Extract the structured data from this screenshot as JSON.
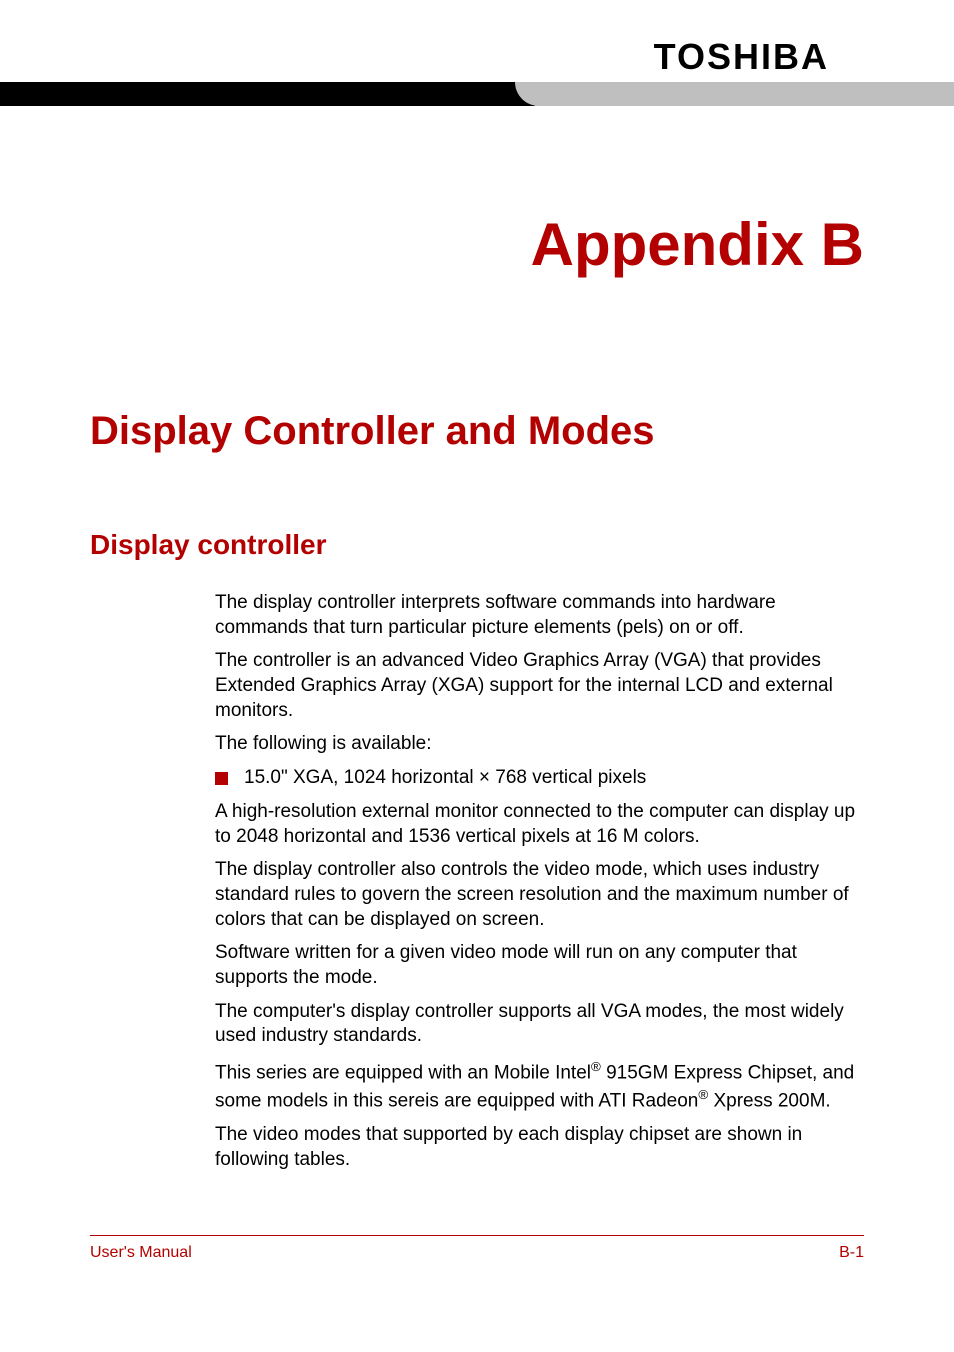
{
  "header": {
    "brand": "TOSHIBA"
  },
  "appendix_title": "Appendix B",
  "chapter_title": "Display Controller and Modes",
  "section_title": "Display controller",
  "body": {
    "p1": "The display controller interprets software commands into hardware commands that turn particular picture elements (pels) on or off.",
    "p2": "The controller is an advanced Video Graphics Array (VGA) that provides Extended Graphics Array (XGA) support for the internal LCD and external monitors.",
    "p3": "The following is available:",
    "bullet1": "15.0\" XGA, 1024 horizontal × 768 vertical pixels",
    "p4": "A high-resolution external monitor connected to the computer can display up to 2048 horizontal and 1536 vertical pixels at 16 M colors.",
    "p5": "The display controller also controls the video mode, which uses industry standard rules to govern the screen resolution and the maximum number of colors that can be displayed on screen.",
    "p6": "Software written for a given video mode will run on any computer that supports the mode.",
    "p7": "The computer's display controller supports all VGA modes, the most widely used industry standards.",
    "p8_a": "This series are equipped with an Mobile Intel",
    "p8_b": " 915GM Express Chipset, and some models in this sereis are equipped with ATI Radeon",
    "p8_c": " Xpress 200M.",
    "reg": "®",
    "p9": "The video modes that supported by each display chipset are shown in following tables."
  },
  "footer": {
    "left": "User's Manual",
    "right": "B-1"
  }
}
